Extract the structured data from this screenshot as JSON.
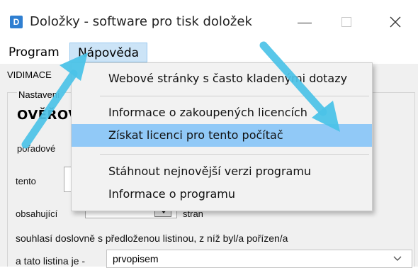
{
  "window": {
    "icon_letter": "D",
    "title": "Doložky - software pro tisk doložek"
  },
  "menubar": {
    "items": [
      "Program",
      "Nápověda"
    ]
  },
  "dropdown": {
    "items": [
      "Webové stránky s často kladenými dotazy",
      "Informace o zakoupených licencích",
      "Získat licenci pro tento počítač",
      "Stáhnout nejnovější verzi programu",
      "Informace o programu"
    ],
    "highlighted_index": 2
  },
  "content": {
    "tab_label": "VIDIMACE",
    "group_title": "Nastavení",
    "big_label": "OVĚŘOVACÍ",
    "poradove_label": "pořadové",
    "tento_label": "tento",
    "obsahuji_label": "obsahující",
    "stran_label": "stran",
    "souhlasi_text": "souhlasí doslovně s předloženou listinou, z níž byl/a pořízen/a",
    "tato_label": "a tato listina je -",
    "listina_value": "prvopisem"
  },
  "colors": {
    "highlight": "#91c9f7",
    "menu_active": "#cce4f7",
    "annotation_arrow": "#4cc3e8",
    "app_icon": "#2f7fd1"
  }
}
